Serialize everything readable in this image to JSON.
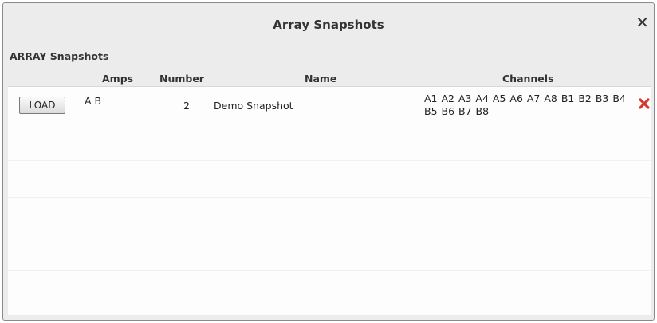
{
  "window": {
    "title": "Array Snapshots",
    "close_glyph": "✕"
  },
  "section": {
    "label": "ARRAY Snapshots"
  },
  "table": {
    "columns": {
      "amps": "Amps",
      "number": "Number",
      "name": "Name",
      "channels": "Channels"
    },
    "rows": [
      {
        "load_label": "LOAD",
        "amps": "A B",
        "number": "2",
        "name": "Demo Snapshot",
        "channels": "A1 A2 A3 A4 A5 A6 A7 A8 B1 B2 B3 B4 B5 B6 B7 B8",
        "delete_icon": "delete-x-icon"
      }
    ]
  },
  "colors": {
    "delete": "#d9362b",
    "window_bg": "#ececec",
    "table_bg": "#fdfdfd"
  }
}
